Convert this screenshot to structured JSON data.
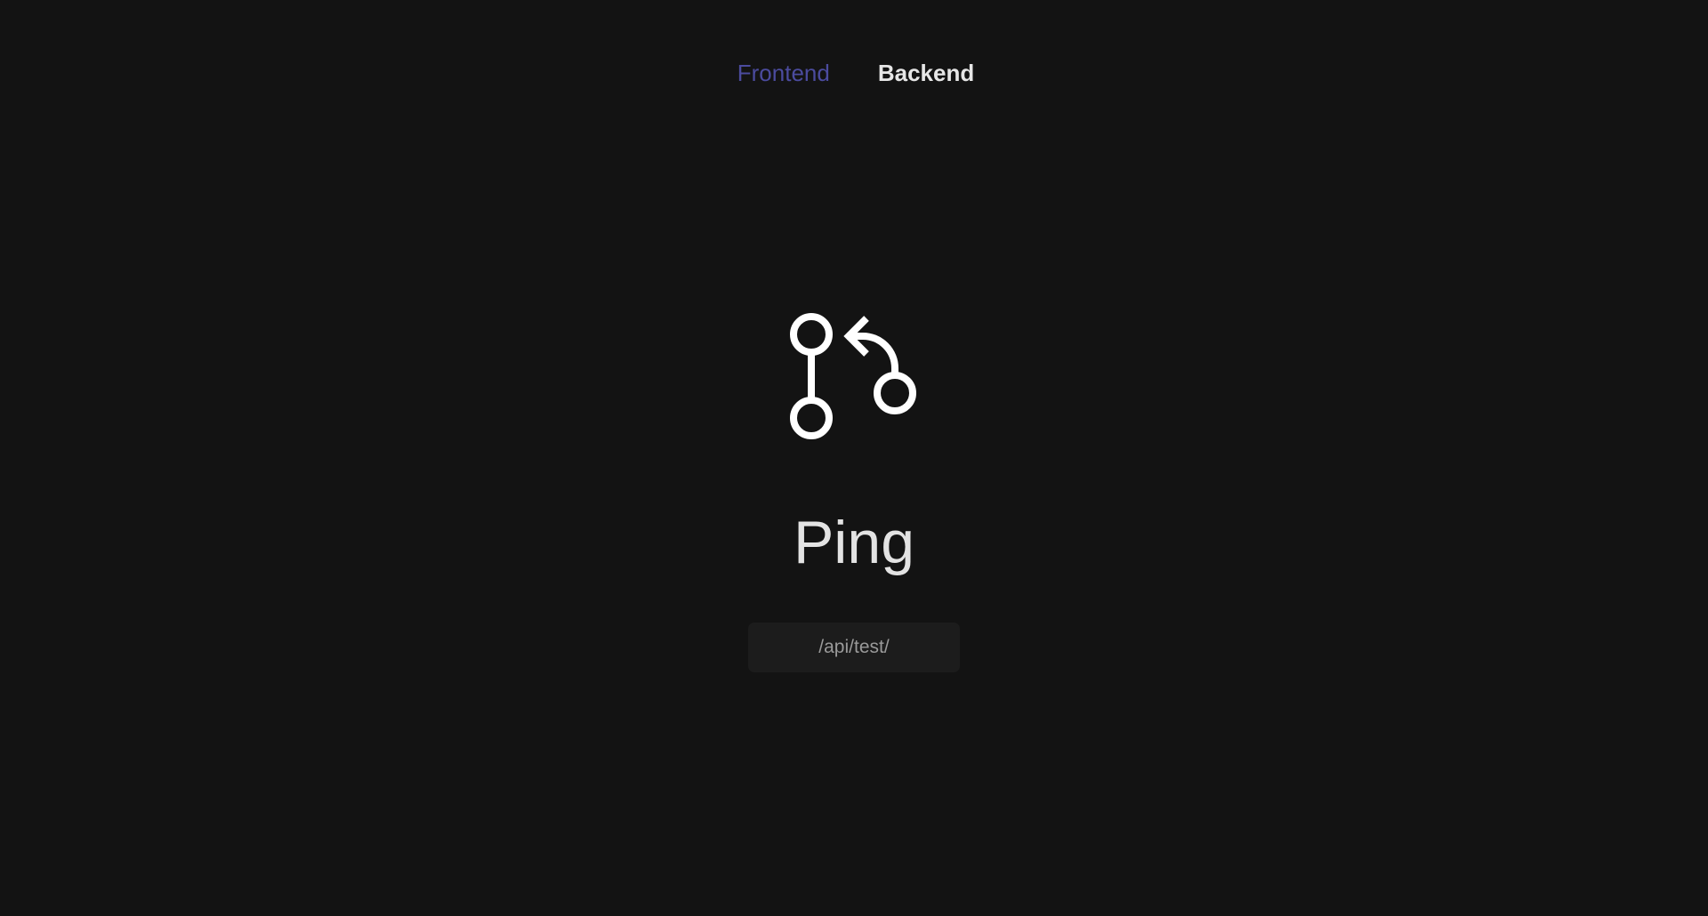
{
  "nav": {
    "items": [
      {
        "label": "Frontend",
        "active": true
      },
      {
        "label": "Backend",
        "active": false
      }
    ]
  },
  "main": {
    "icon": "git-pull-request-icon",
    "title": "Ping",
    "endpoint": "/api/test/"
  },
  "colors": {
    "background": "#131313",
    "accent": "#4b4b9e",
    "text": "#e3e3e3",
    "endpoint_bg": "#1c1c1c",
    "endpoint_text": "#9a9a9a"
  }
}
